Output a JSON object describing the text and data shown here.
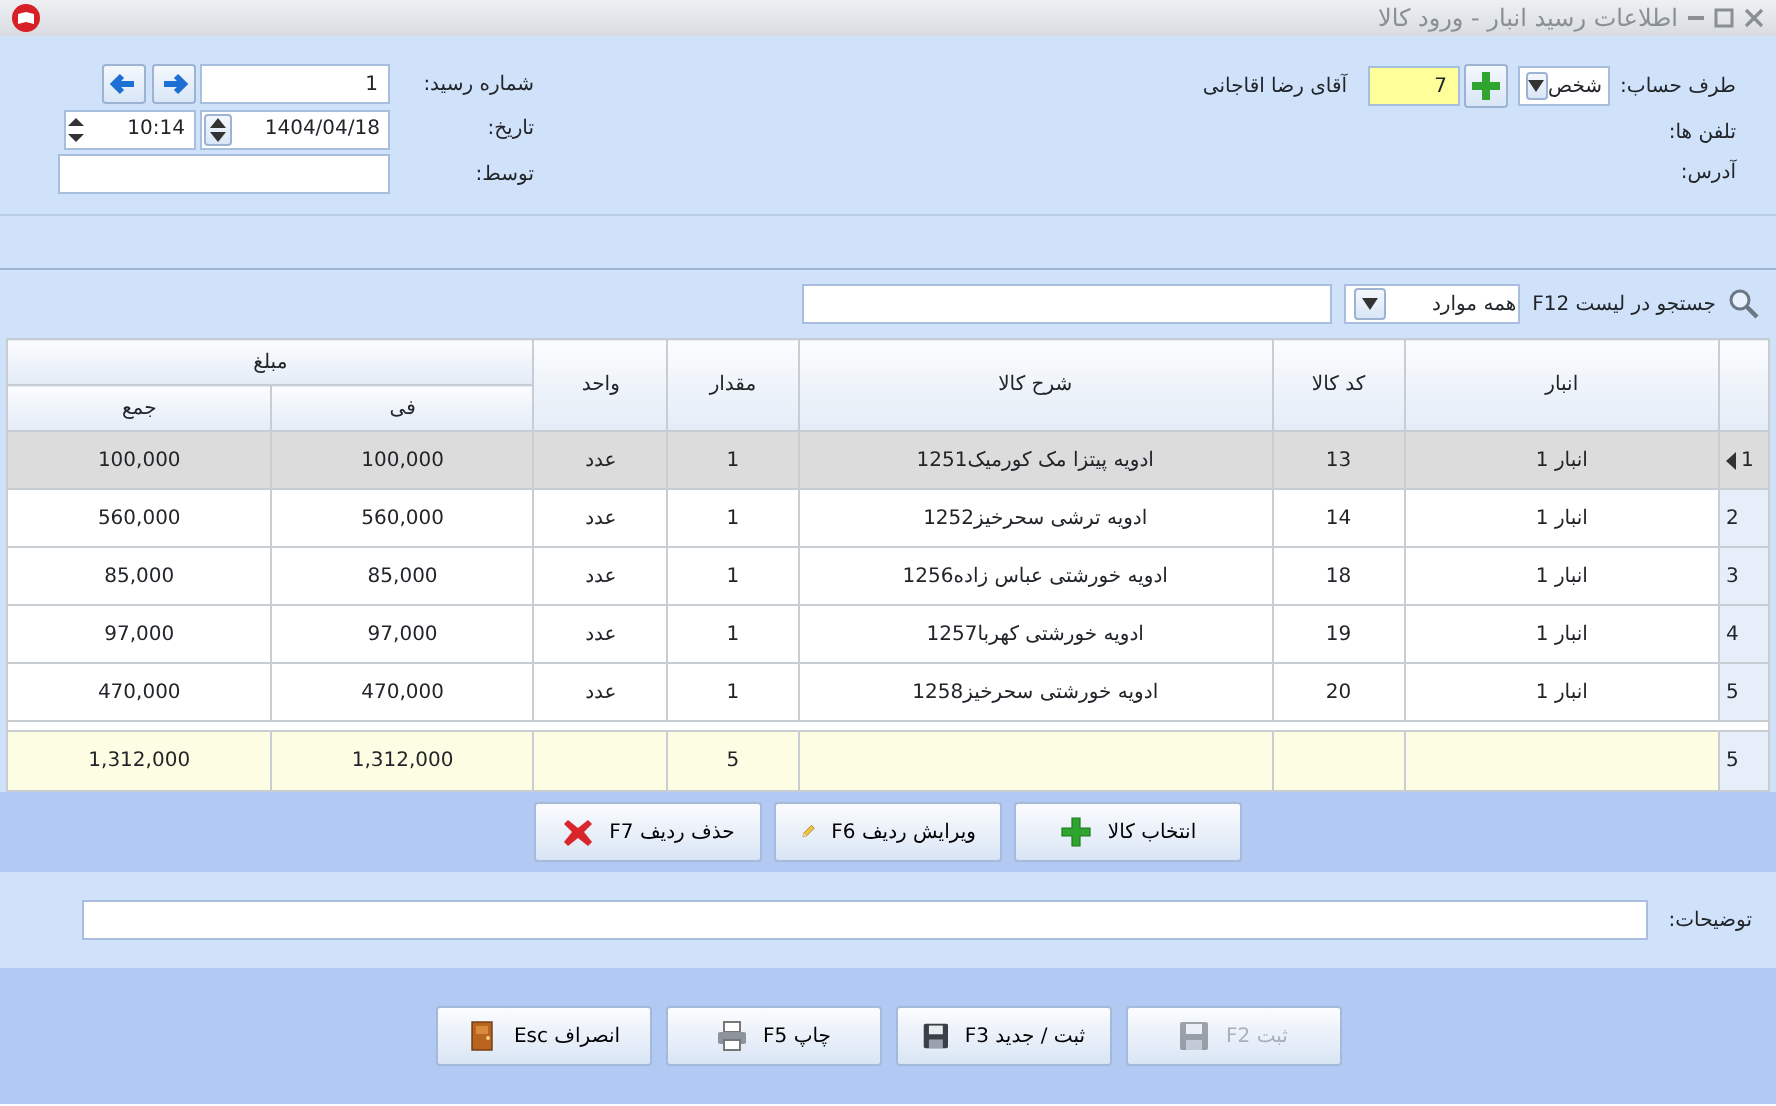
{
  "window": {
    "title": "اطلاعات رسید انبار - ورود کالا"
  },
  "header": {
    "account_label": "طرف حساب:",
    "account_type": "شخص",
    "account_code": "7",
    "account_name": "آقای رضا اقاجانی",
    "phones_label": "تلفن ها:",
    "address_label": "آدرس:",
    "receipt_number_label": "شماره رسید:",
    "receipt_number": "1",
    "date_label": "تاریخ:",
    "date": "1404/04/18",
    "time": "10:14",
    "by_label": "توسط:"
  },
  "search": {
    "label": "جستجو در لیست F12",
    "filter": "همه موارد"
  },
  "table": {
    "columns": [
      "انبار",
      "کد کالا",
      "شرح کالا",
      "مقدار",
      "واحد"
    ],
    "amount_group": "مبلغ",
    "amount_columns": [
      "فی",
      "جمع"
    ],
    "rows": [
      {
        "row_number": "1",
        "selected": true,
        "cells": [
          "انبار 1",
          "13",
          "ادویه پیتزا مک کورمیک1251",
          "1",
          "عدد",
          "100,000",
          "100,000"
        ]
      },
      {
        "row_number": "2",
        "selected": false,
        "cells": [
          "انبار 1",
          "14",
          "ادویه ترشی سحرخیز1252",
          "1",
          "عدد",
          "560,000",
          "560,000"
        ]
      },
      {
        "row_number": "3",
        "selected": false,
        "cells": [
          "انبار 1",
          "18",
          "ادویه خورشتی عباس زاده1256",
          "1",
          "عدد",
          "85,000",
          "85,000"
        ]
      },
      {
        "row_number": "4",
        "selected": false,
        "cells": [
          "انبار 1",
          "19",
          "ادویه خورشتی کهربا1257",
          "1",
          "عدد",
          "97,000",
          "97,000"
        ]
      },
      {
        "row_number": "5",
        "selected": false,
        "cells": [
          "انبار 1",
          "20",
          "ادویه خورشتی سحرخیز1258",
          "1",
          "عدد",
          "470,000",
          "470,000"
        ]
      }
    ],
    "footer": {
      "row_count": "5",
      "quantity": "5",
      "unit_price_total": "1,312,000",
      "total": "1,312,000"
    }
  },
  "row_buttons": [
    {
      "label": "انتخاب کالا",
      "kind": "plus"
    },
    {
      "label": "ویرایش ردیف F6",
      "kind": "pencil"
    },
    {
      "label": "حذف ردیف F7",
      "kind": "delete"
    }
  ],
  "notes": {
    "label": "توضیحات:"
  },
  "action_buttons": [
    {
      "label": "ثبت F2",
      "kind": "save",
      "disabled": true
    },
    {
      "label": "ثبت / جدید F3",
      "kind": "save-new",
      "disabled": false
    },
    {
      "label": "چاپ F5",
      "kind": "print",
      "disabled": false
    },
    {
      "label": "انصراف Esc",
      "kind": "exit",
      "disabled": false
    }
  ]
}
